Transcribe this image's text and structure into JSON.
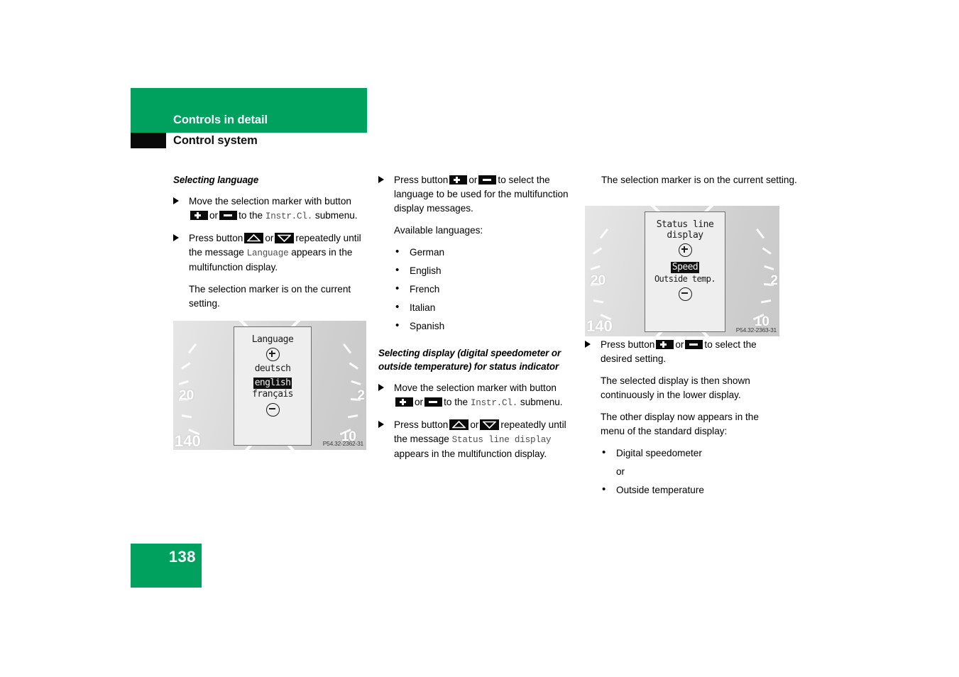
{
  "header": {
    "chapter": "Controls in detail",
    "section": "Control system"
  },
  "columns": {
    "col1": {
      "subhead": "Selecting language",
      "step1_a": "Move the selection marker with button",
      "step1_or": "or",
      "step1_b": "to the",
      "step1_code": "Instr.Cl.",
      "step1_c": "submenu.",
      "step2_a": "Press button",
      "step2_or": "or",
      "step2_b": "repeatedly until the message",
      "step2_code": "Language",
      "step2_c": "appears in the multifunction display.",
      "note": "The selection marker is on the current setting."
    },
    "col2": {
      "step1_a": "Press button",
      "step1_or": "or",
      "step1_b": "to select the language to be used for the multifunction display messages.",
      "available_label": "Available languages:",
      "languages": [
        "German",
        "English",
        "French",
        "Italian",
        "Spanish"
      ],
      "subhead": "Selecting display (digital speedometer or outside temperature) for status indicator",
      "step2_a": "Move the selection marker with button",
      "step2_or": "or",
      "step2_b": "to the",
      "step2_code": "Instr.Cl.",
      "step2_c": "submenu.",
      "step3_a": "Press button",
      "step3_or": "or",
      "step3_b": "repeatedly until the message",
      "step3_code": "Status line display",
      "step3_c": "appears in the multifunction display."
    },
    "col3": {
      "note1": "The selection marker is on the current setting.",
      "step1_a": "Press button",
      "step1_or": "or",
      "step1_b": "to select the desired setting.",
      "note2": "The selected display is then shown continuously in the lower display.",
      "note3": "The other display now appears in the menu of the standard display:",
      "options": [
        "Digital speedometer",
        "Outside temperature"
      ],
      "options_or": "or"
    }
  },
  "figures": {
    "fig1": {
      "caption": "P54.32-2362-31",
      "lcd_title": "Language",
      "plus_icon": "circle-plus-icon",
      "minus_icon": "circle-minus-icon",
      "options": [
        "deutsch",
        "english",
        "français"
      ],
      "selected": "english",
      "gauge_left_number": "20",
      "gauge_left_number2": "140",
      "gauge_right_number": "2",
      "gauge_right_number2": "10"
    },
    "fig2": {
      "caption": "P54.32-2363-31",
      "lcd_title_line1": "Status line",
      "lcd_title_line2": "display",
      "plus_icon": "circle-plus-icon",
      "minus_icon": "circle-minus-icon",
      "options": [
        "Speed",
        "Outside temp."
      ],
      "selected": "Speed",
      "gauge_left_number": "20",
      "gauge_left_number2": "140",
      "gauge_right_number": "2",
      "gauge_right_number2": "10"
    }
  },
  "footer": {
    "page_number": "138"
  },
  "colors": {
    "brand_green": "#00a05f",
    "black": "#0a0a0a",
    "mono_gray": "#4d4d4d"
  }
}
